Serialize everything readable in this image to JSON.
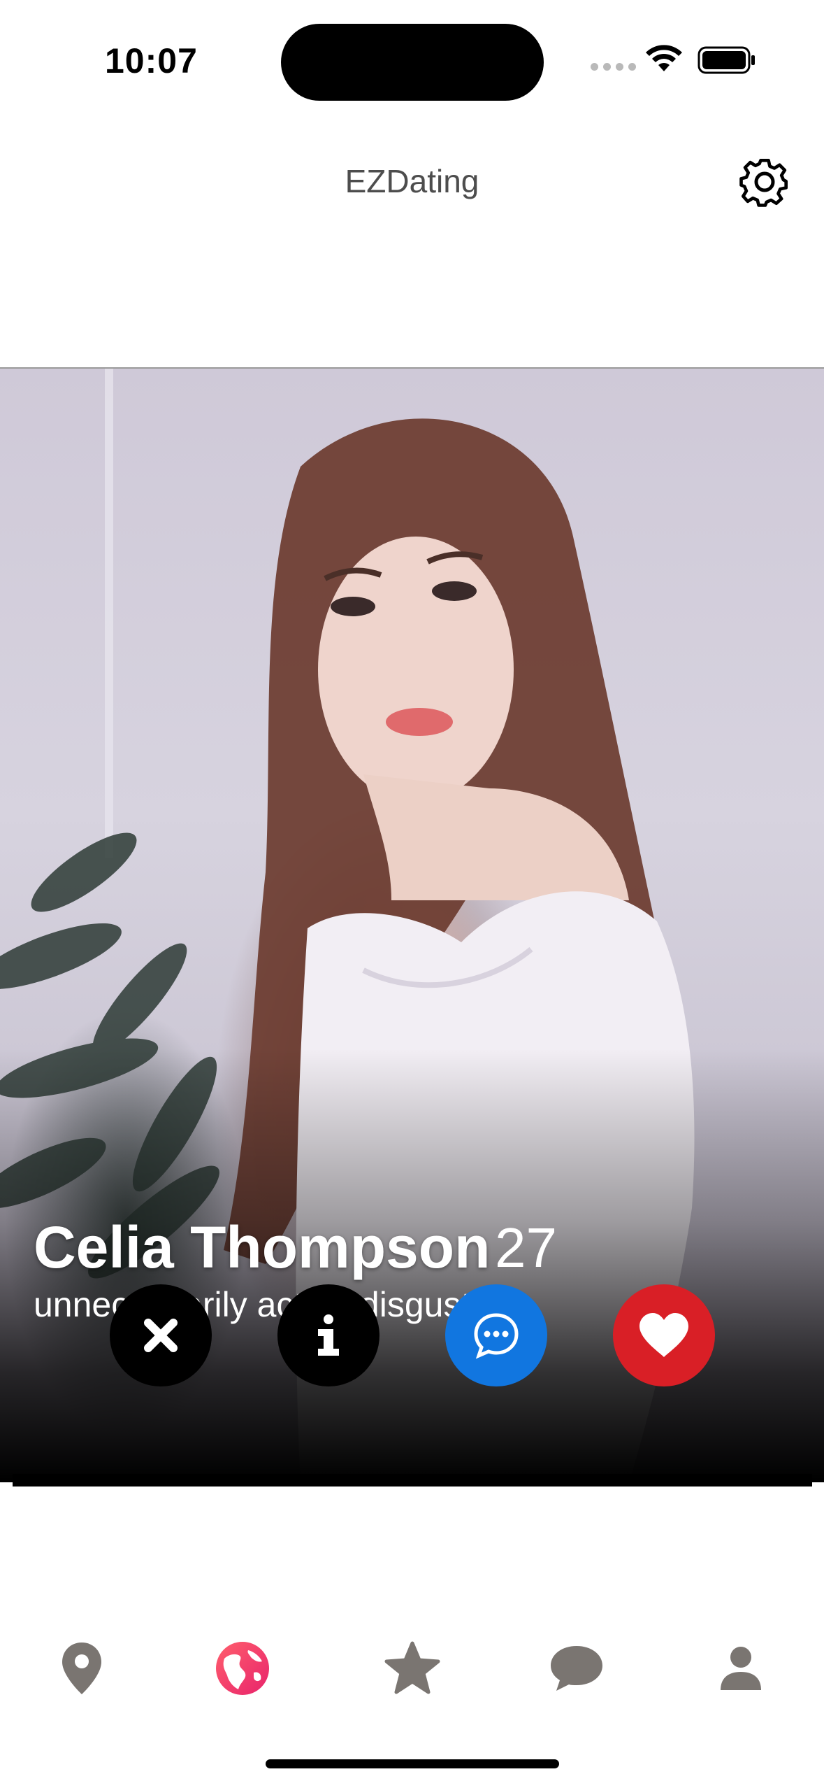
{
  "status_bar": {
    "time": "10:07"
  },
  "header": {
    "title": "EZDating"
  },
  "profile": {
    "name": "Celia Thompson",
    "age": "27",
    "bio": "unnecessarily acting disgusting"
  },
  "actions": {
    "pass_color": "#000000",
    "info_color": "#000000",
    "message_color": "#1176e0",
    "like_color": "#d91f26"
  },
  "tab_bar": {
    "items": [
      {
        "icon": "location-pin-icon",
        "active": false
      },
      {
        "icon": "globe-icon",
        "active": true
      },
      {
        "icon": "star-icon",
        "active": false
      },
      {
        "icon": "chat-bubble-icon",
        "active": false
      },
      {
        "icon": "person-icon",
        "active": false
      }
    ],
    "inactive_color": "#7a7571",
    "active_gradient": [
      "#ff5f6d",
      "#e8236b"
    ]
  }
}
